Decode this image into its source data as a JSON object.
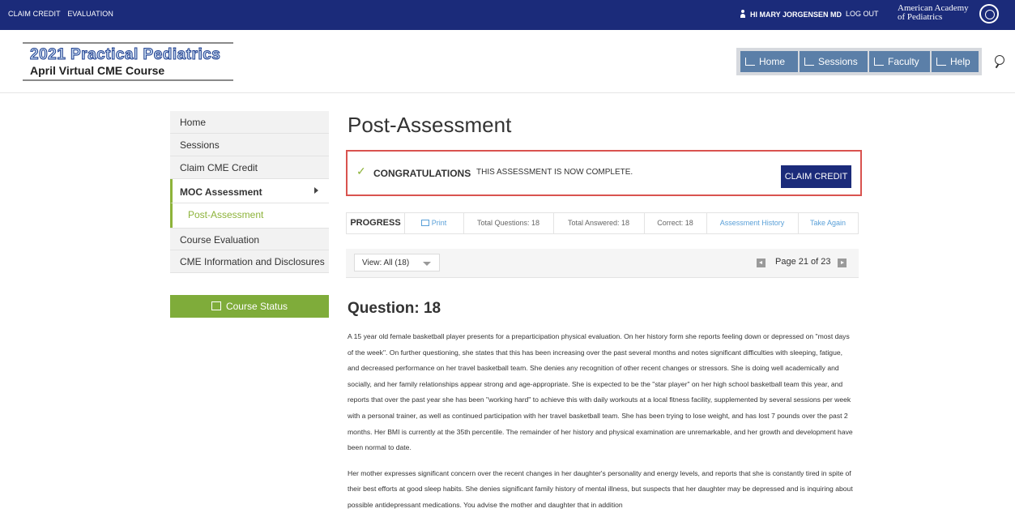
{
  "topbar": {
    "links": [
      "CLAIM CREDIT",
      "EVALUATION"
    ],
    "user_greeting": "HI MARY JORGENSEN MD",
    "logout": "LOG OUT",
    "org_line1": "American Academy",
    "org_line2": "of Pediatrics"
  },
  "brand": {
    "title": "2021 Practical Pediatrics",
    "subtitle": "April Virtual CME Course"
  },
  "nav": {
    "items": [
      "Home",
      "Sessions",
      "Faculty",
      "Help"
    ]
  },
  "sidebar": {
    "items": [
      {
        "label": "Home"
      },
      {
        "label": "Sessions"
      },
      {
        "label": "Claim CME Credit"
      },
      {
        "label": "MOC Assessment"
      },
      {
        "label": "Post-Assessment"
      },
      {
        "label": "Course Evaluation"
      },
      {
        "label": "CME Information and Disclosures"
      }
    ],
    "course_status": "Course Status"
  },
  "main": {
    "title": "Post-Assessment",
    "congrats": {
      "check": "✓",
      "label": "CONGRATULATIONS",
      "message": "THIS ASSESSMENT IS NOW COMPLETE.",
      "claim_button": "CLAIM CREDIT"
    },
    "progress": {
      "label": "PROGRESS",
      "print": "Print",
      "total_questions": "Total Questions: 18",
      "total_answered": "Total Answered: 18",
      "correct": "Correct: 18",
      "history": "Assessment History",
      "take_again": "Take Again"
    },
    "view": {
      "select_value": "View: All (18)",
      "page_text": "Page 21 of 23"
    },
    "question": {
      "heading": "Question: 18",
      "paragraphs": [
        "A 15 year old female basketball player presents for a preparticipation physical evaluation.  On her history form she reports feeling down or depressed on \"most days of the week\".  On further questioning, she states that this has been increasing over the past several months and notes significant difficulties with sleeping, fatigue, and decreased performance on her travel basketball team.  She denies any recognition of other recent changes or stressors.  She is doing well academically and socially, and her family relationships appear strong and age-appropriate.  She is expected to be the \"star player\" on her high school basketball team this year, and reports that over the past year she has been \"working hard\" to achieve this with daily workouts at a local fitness facility, supplemented by several sessions per week with a personal trainer, as well as continued participation with her travel basketball team. She has been trying to lose weight, and has lost 7 pounds over the past 2 months.  Her BMI is currently at the 35th percentile.  The remainder of her history and physical examination are unremarkable, and her growth and development have been normal to date.",
        "Her mother expresses significant concern over the recent changes in her daughter's personality and energy levels, and reports that she is constantly tired in spite of their best efforts at good sleep habits.  She denies significant family history of mental illness, but suspects that her daughter may be depressed and is inquiring about possible antidepressant medications.  You advise the mother and daughter that in addition"
      ]
    }
  },
  "colors": {
    "topbar": "#1b2b7a",
    "accent_green": "#8db33a",
    "nav_button": "#5b7fa8",
    "highlight_border": "#d9534f",
    "link": "#5aa0d8"
  }
}
